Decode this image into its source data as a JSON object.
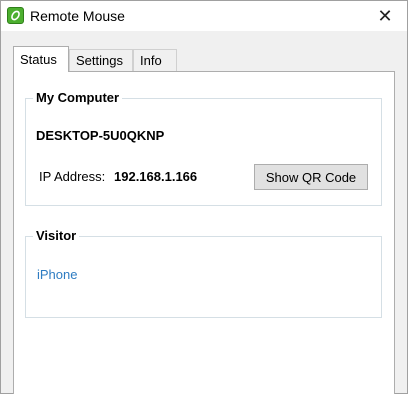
{
  "window": {
    "title": "Remote Mouse",
    "icon": "remote-mouse-app-icon",
    "close_glyph": "✕"
  },
  "tabs": [
    {
      "label": "Status",
      "active": true
    },
    {
      "label": "Settings",
      "active": false
    },
    {
      "label": "Info",
      "active": false
    }
  ],
  "my_computer": {
    "heading": "My Computer",
    "name": "DESKTOP-5U0QKNP",
    "ip_label": "IP Address:",
    "ip_value": "192.168.1.166",
    "qr_button_label": "Show QR Code"
  },
  "visitor": {
    "heading": "Visitor",
    "device": "iPhone",
    "device_color": "#2e7cc2"
  }
}
